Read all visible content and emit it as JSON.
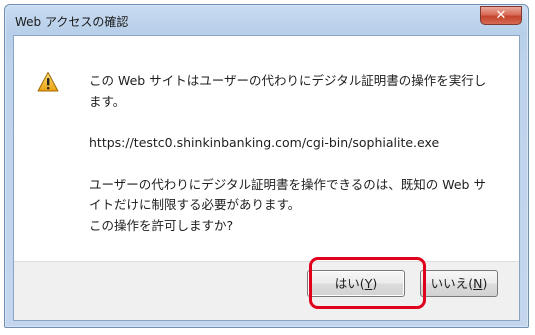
{
  "dialog": {
    "title": "Web アクセスの確認",
    "close_icon": "close-x-icon",
    "warning_icon": "warning-triangle-icon",
    "message_line1": "この Web サイトはユーザーの代わりにデジタル証明書の操作を実行し",
    "message_line2": "ます。",
    "url": "https://testc0.shinkinbanking.com/cgi-bin/sophialite.exe",
    "detail_line1": "ユーザーの代わりにデジタル証明書を操作できるのは、既知の Web サ",
    "detail_line2": "イトだけに制限する必要があります。",
    "question": "この操作を許可しますか?"
  },
  "buttons": {
    "yes_label": "はい",
    "yes_accel": "Y",
    "no_label": "いいえ",
    "no_accel": "N"
  },
  "colors": {
    "highlight": "#e0001b",
    "titlebar": "#c3d6ee",
    "close_button": "#c4432c"
  }
}
